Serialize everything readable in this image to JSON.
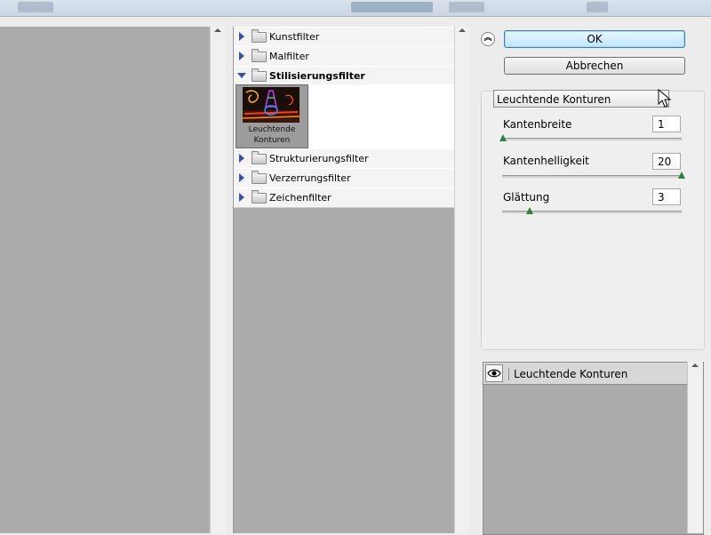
{
  "gallery": {
    "categories": [
      {
        "label": "Kunstfilter",
        "expanded": false
      },
      {
        "label": "Malfilter",
        "expanded": false
      },
      {
        "label": "Stilisierungsfilter",
        "expanded": true
      },
      {
        "label": "Strukturierungsfilter",
        "expanded": false
      },
      {
        "label": "Verzerrungsfilter",
        "expanded": false
      },
      {
        "label": "Zeichenfilter",
        "expanded": false
      }
    ],
    "thumbnail": {
      "caption_line1": "Leuchtende",
      "caption_line2": "Konturen"
    }
  },
  "dialog": {
    "ok_label": "OK",
    "cancel_label": "Abbrechen",
    "collapse_icon": "double-chevron-up-icon",
    "filter_select": "Leuchtende Konturen"
  },
  "params": [
    {
      "label": "Kantenbreite",
      "value": "1",
      "level": 0.0
    },
    {
      "label": "Kantenhelligkeit",
      "value": "20",
      "level": 1.0
    },
    {
      "label": "Glättung",
      "value": "3",
      "level": 0.15
    }
  ],
  "layers": {
    "items": [
      {
        "name": "Leuchtende Konturen",
        "visible_icon": "eye-icon"
      }
    ]
  }
}
